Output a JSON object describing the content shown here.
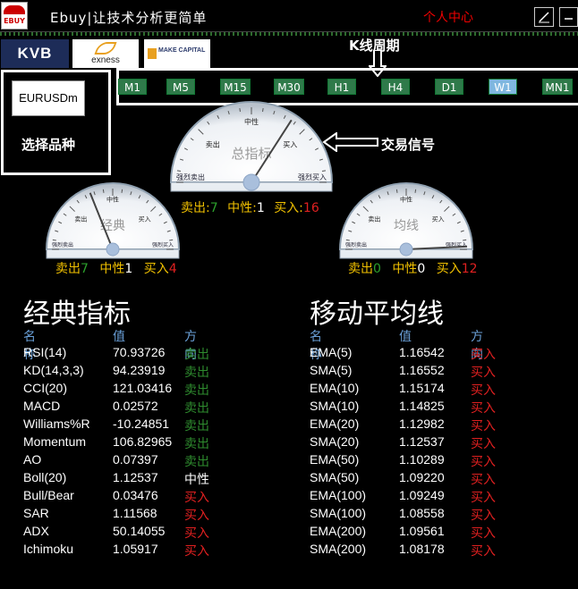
{
  "titlebar": {
    "logo_text": "EBUY",
    "title": "Ebuy|让技术分析更简单",
    "user_center": "个人中心",
    "maximize_icon": "diagonal-line-icon",
    "minimize_icon": "minimize-icon"
  },
  "brokers": {
    "kvb": "KVB",
    "exness": "exness",
    "make_capital": "MAKE CAPITAL"
  },
  "annotations": {
    "kline_period": "K线周期",
    "choose_symbol": "选择品种",
    "trade_signal": "交易信号"
  },
  "symbol": "EURUSDm",
  "timeframes": [
    {
      "label": "M1",
      "active": false
    },
    {
      "label": "M5",
      "active": false
    },
    {
      "label": "M15",
      "active": false
    },
    {
      "label": "M30",
      "active": false
    },
    {
      "label": "H1",
      "active": false
    },
    {
      "label": "H4",
      "active": false
    },
    {
      "label": "D1",
      "active": false
    },
    {
      "label": "W1",
      "active": true
    },
    {
      "label": "MN1",
      "active": false
    }
  ],
  "gauges": {
    "summary": {
      "name": "总指标",
      "scale_sell": "卖出",
      "scale_neutral": "中性",
      "scale_buy": "买入",
      "scale_strong_sell": "强烈卖出",
      "scale_strong_buy": "强烈买入",
      "sell_label": "卖出:",
      "sell": 7,
      "neutral_label": "中性:",
      "neutral": 1,
      "buy_label": "买入:",
      "buy": 16
    },
    "classic": {
      "name": "经典",
      "scale_sell": "卖出",
      "scale_neutral": "中性",
      "scale_buy": "买入",
      "scale_strong_sell": "强烈卖出",
      "scale_strong_buy": "强烈买入",
      "sell_label": "卖出",
      "sell": 7,
      "neutral_label": "中性",
      "neutral": 1,
      "buy_label": "买入",
      "buy": 4
    },
    "ma": {
      "name": "均线",
      "scale_sell": "卖出",
      "scale_neutral": "中性",
      "scale_buy": "买入",
      "scale_strong_sell": "强烈卖出",
      "scale_strong_buy": "强烈买入",
      "sell_label": "卖出",
      "sell": 0,
      "neutral_label": "中性",
      "neutral": 0,
      "buy_label": "买入",
      "buy": 12
    }
  },
  "classic_table": {
    "title": "经典指标",
    "headers": [
      "名称",
      "值",
      "方向"
    ],
    "rows": [
      {
        "name": "RSI(14)",
        "value": "70.93726",
        "dir": "卖出",
        "kind": "sell"
      },
      {
        "name": "KD(14,3,3)",
        "value": "94.23919",
        "dir": "卖出",
        "kind": "sell"
      },
      {
        "name": "CCI(20)",
        "value": "121.03416",
        "dir": "卖出",
        "kind": "sell"
      },
      {
        "name": "MACD",
        "value": "0.02572",
        "dir": "卖出",
        "kind": "sell"
      },
      {
        "name": "Williams%R",
        "value": "-10.24851",
        "dir": "卖出",
        "kind": "sell"
      },
      {
        "name": "Momentum",
        "value": "106.82965",
        "dir": "卖出",
        "kind": "sell"
      },
      {
        "name": "AO",
        "value": "0.07397",
        "dir": "卖出",
        "kind": "sell"
      },
      {
        "name": "Boll(20)",
        "value": "1.12537",
        "dir": "中性",
        "kind": "neutral"
      },
      {
        "name": "Bull/Bear",
        "value": "0.03476",
        "dir": "买入",
        "kind": "buy"
      },
      {
        "name": "SAR",
        "value": "1.11568",
        "dir": "买入",
        "kind": "buy"
      },
      {
        "name": "ADX",
        "value": "50.14055",
        "dir": "买入",
        "kind": "buy"
      },
      {
        "name": "Ichimoku",
        "value": "1.05917",
        "dir": "买入",
        "kind": "buy"
      }
    ]
  },
  "ma_table": {
    "title": "移动平均线",
    "headers": [
      "名称",
      "值",
      "方向"
    ],
    "rows": [
      {
        "name": "EMA(5)",
        "value": "1.16542",
        "dir": "买入",
        "kind": "buy"
      },
      {
        "name": "SMA(5)",
        "value": "1.16552",
        "dir": "买入",
        "kind": "buy"
      },
      {
        "name": "EMA(10)",
        "value": "1.15174",
        "dir": "买入",
        "kind": "buy"
      },
      {
        "name": "SMA(10)",
        "value": "1.14825",
        "dir": "买入",
        "kind": "buy"
      },
      {
        "name": "EMA(20)",
        "value": "1.12982",
        "dir": "买入",
        "kind": "buy"
      },
      {
        "name": "SMA(20)",
        "value": "1.12537",
        "dir": "买入",
        "kind": "buy"
      },
      {
        "name": "EMA(50)",
        "value": "1.10289",
        "dir": "买入",
        "kind": "buy"
      },
      {
        "name": "SMA(50)",
        "value": "1.09220",
        "dir": "买入",
        "kind": "buy"
      },
      {
        "name": "EMA(100)",
        "value": "1.09249",
        "dir": "买入",
        "kind": "buy"
      },
      {
        "name": "SMA(100)",
        "value": "1.08558",
        "dir": "买入",
        "kind": "buy"
      },
      {
        "name": "EMA(200)",
        "value": "1.09561",
        "dir": "买入",
        "kind": "buy"
      },
      {
        "name": "SMA(200)",
        "value": "1.08178",
        "dir": "买入",
        "kind": "buy"
      }
    ]
  }
}
